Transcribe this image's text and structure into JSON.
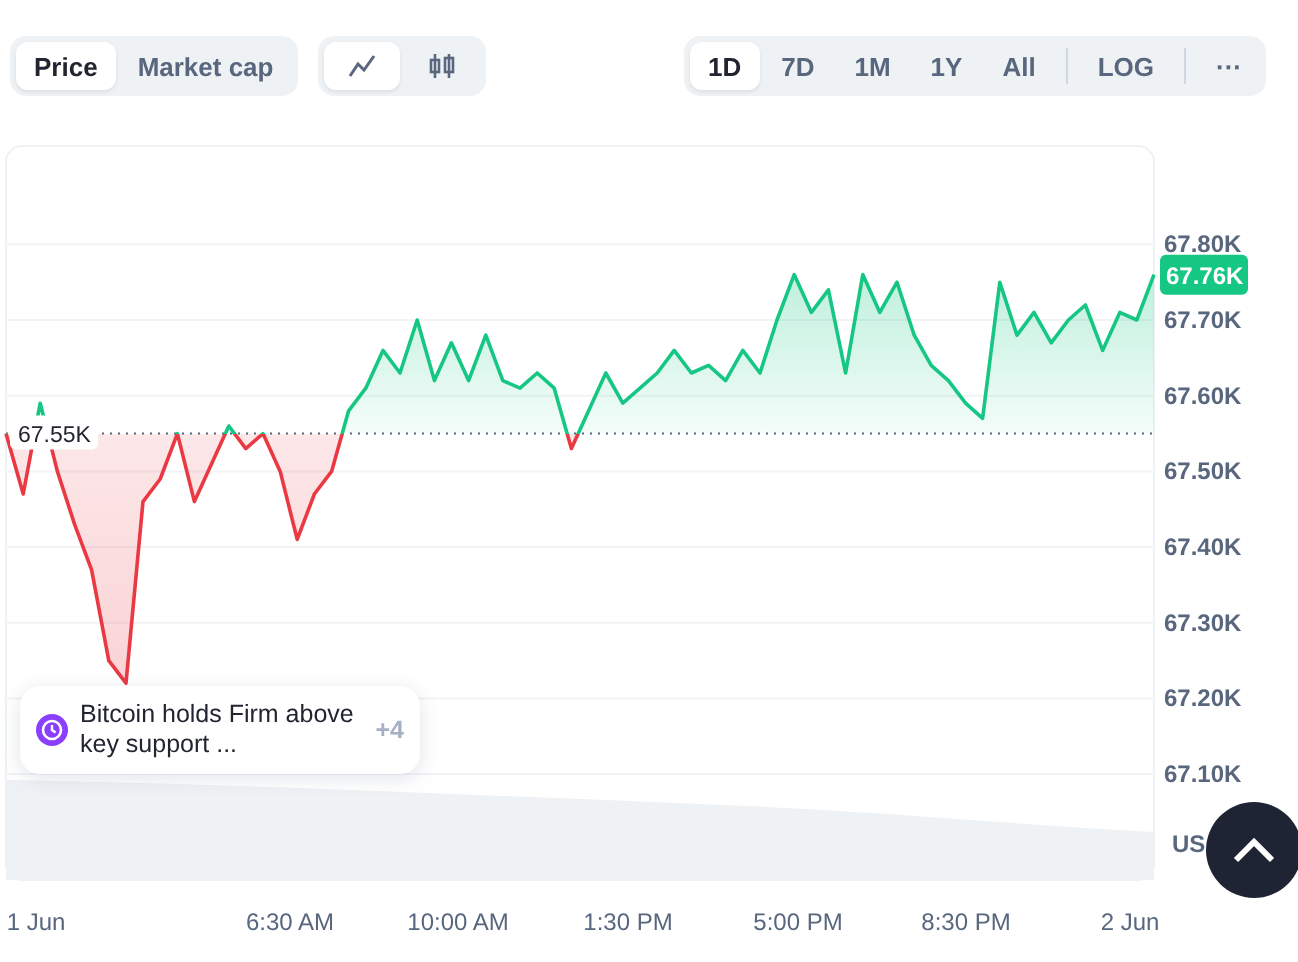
{
  "view_tabs": [
    {
      "label": "Price",
      "selected": true
    },
    {
      "label": "Market cap",
      "selected": false
    }
  ],
  "chart_types": [
    {
      "kind": "line",
      "selected": true
    },
    {
      "kind": "candles",
      "selected": false
    }
  ],
  "ranges": [
    {
      "label": "1D",
      "selected": true
    },
    {
      "label": "7D",
      "selected": false
    },
    {
      "label": "1M",
      "selected": false
    },
    {
      "label": "1Y",
      "selected": false
    },
    {
      "label": "All",
      "selected": false
    }
  ],
  "scale_button": "LOG",
  "more_button": "···",
  "chart": {
    "axis_unit": "US",
    "price_label": "67.76K",
    "x_axis_labels": [
      "1 Jun",
      "6:30 AM",
      "10:00 AM",
      "1:30 PM",
      "5:00 PM",
      "8:30 PM",
      "2 Jun"
    ],
    "chart_data": {
      "type": "area",
      "ylim": [
        66.96,
        67.93
      ],
      "grid": true,
      "yticks": [
        {
          "value": 67.8,
          "label": "67.80K"
        },
        {
          "value": 67.7,
          "label": "67.70K"
        },
        {
          "value": 67.6,
          "label": "67.60K"
        },
        {
          "value": 67.5,
          "label": "67.50K"
        },
        {
          "value": 67.4,
          "label": "67.40K"
        },
        {
          "value": 67.3,
          "label": "67.30K"
        },
        {
          "value": 67.2,
          "label": "67.20K"
        },
        {
          "value": 67.1,
          "label": "67.10K"
        }
      ],
      "ref_lines": [
        {
          "axis": "y",
          "value": 67.55,
          "label": "67.55K"
        }
      ],
      "series": [
        {
          "color": "#16c784",
          "values": [
            67.55,
            67.47,
            67.59,
            67.5,
            67.43,
            67.37,
            67.25,
            67.22,
            67.46,
            67.49,
            67.55,
            67.46,
            67.51,
            67.56,
            67.53,
            67.55,
            67.5,
            67.41,
            67.47,
            67.5,
            67.58,
            67.61,
            67.66,
            67.63,
            67.7,
            67.62,
            67.67,
            67.62,
            67.68,
            67.62,
            67.61,
            67.63,
            67.61,
            67.53,
            67.58,
            67.63,
            67.59,
            67.61,
            67.63,
            67.66,
            67.63,
            67.64,
            67.62,
            67.66,
            67.63,
            67.7,
            67.76,
            67.71,
            67.74,
            67.63,
            67.76,
            67.71,
            67.75,
            67.68,
            67.64,
            67.62,
            67.59,
            67.57,
            67.75,
            67.68,
            67.71,
            67.67,
            67.7,
            67.72,
            67.66,
            67.71,
            67.7,
            67.76
          ]
        }
      ]
    }
  },
  "news": {
    "title": "Bitcoin holds Firm above key support ...",
    "count": "+4"
  }
}
